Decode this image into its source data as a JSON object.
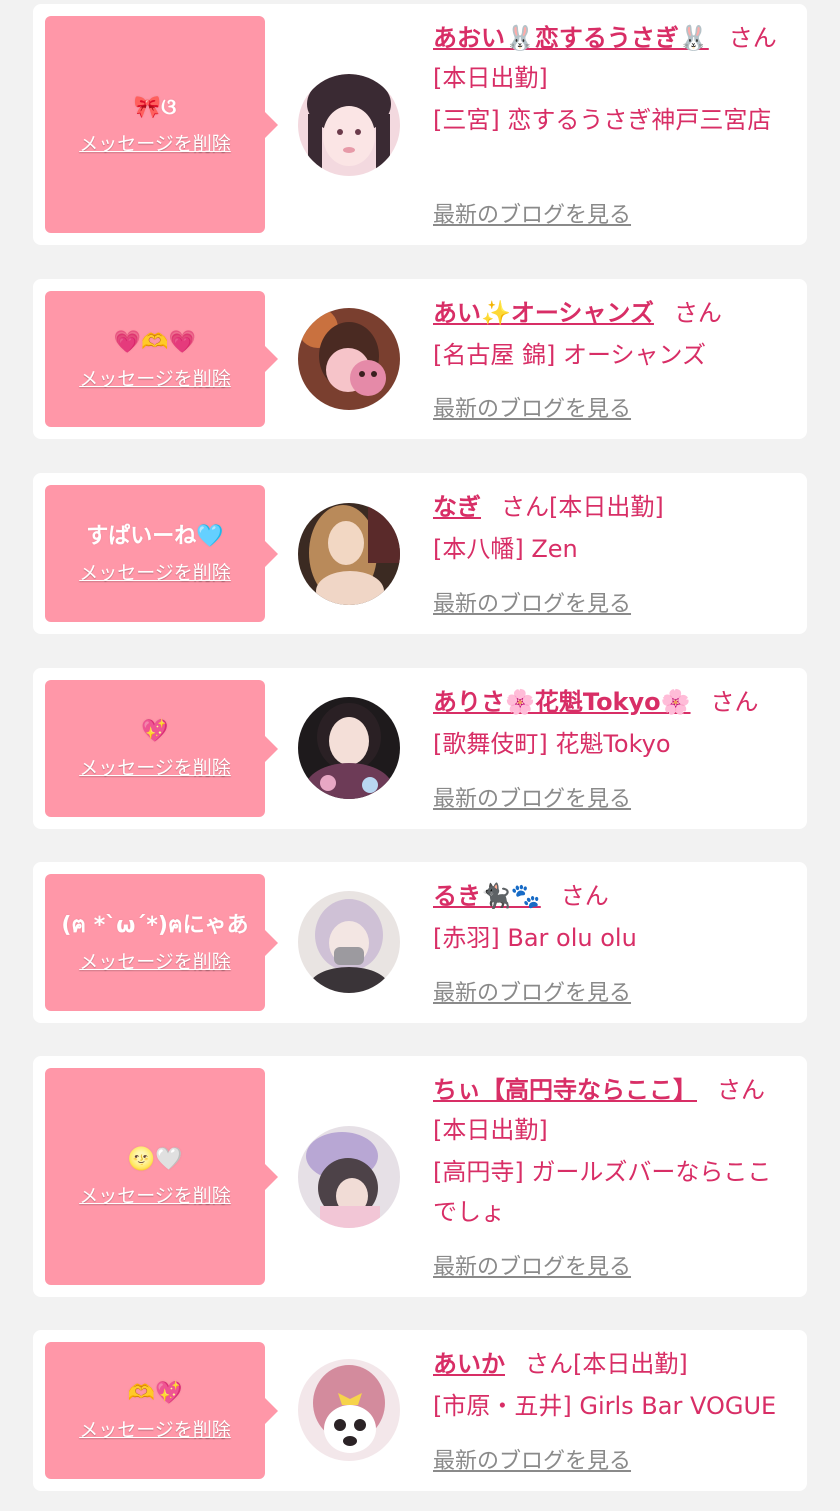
{
  "delete_label": "メッセージを削除",
  "blog_label": "最新のブログを見る",
  "suffix_label": "さん",
  "colors": {
    "background": "#f2f2f2",
    "card": "#ffffff",
    "bubble": "#ff97a8",
    "accent": "#d82e66",
    "link_gray": "#8a8a8a"
  },
  "items": [
    {
      "message": "🎀ଓ",
      "name": "あおい🐰恋するうさぎ🐰",
      "status": "[本日出勤]",
      "shop": "[三宮] 恋するうさぎ神戸三宮店"
    },
    {
      "message": "💗🫶💗",
      "name": "あい✨オーシャンズ",
      "status": "",
      "shop": "[名古屋 錦] オーシャンズ"
    },
    {
      "message": "すぱいーね🩵",
      "name": "なぎ",
      "status": "[本日出勤]",
      "shop": "[本八幡] Zen"
    },
    {
      "message": "💖",
      "name": "ありさ🌸花魁Tokyo🌸",
      "status": "",
      "shop": "[歌舞伎町] 花魁Tokyo"
    },
    {
      "message": "(ฅ *`ω´*)ฅにゃあ",
      "name": "るき🐈‍⬛🐾",
      "status": "",
      "shop": "[赤羽] Bar olu olu"
    },
    {
      "message": "🌝🤍",
      "name": "ちぃ【高円寺ならここ】",
      "status": "[本日出勤]",
      "shop": "[高円寺] ガールズバーならここでしょ"
    },
    {
      "message": "🫶💖",
      "name": "あいか",
      "status": "[本日出勤]",
      "shop": "[市原・五井] Girls Bar VOGUE"
    }
  ]
}
